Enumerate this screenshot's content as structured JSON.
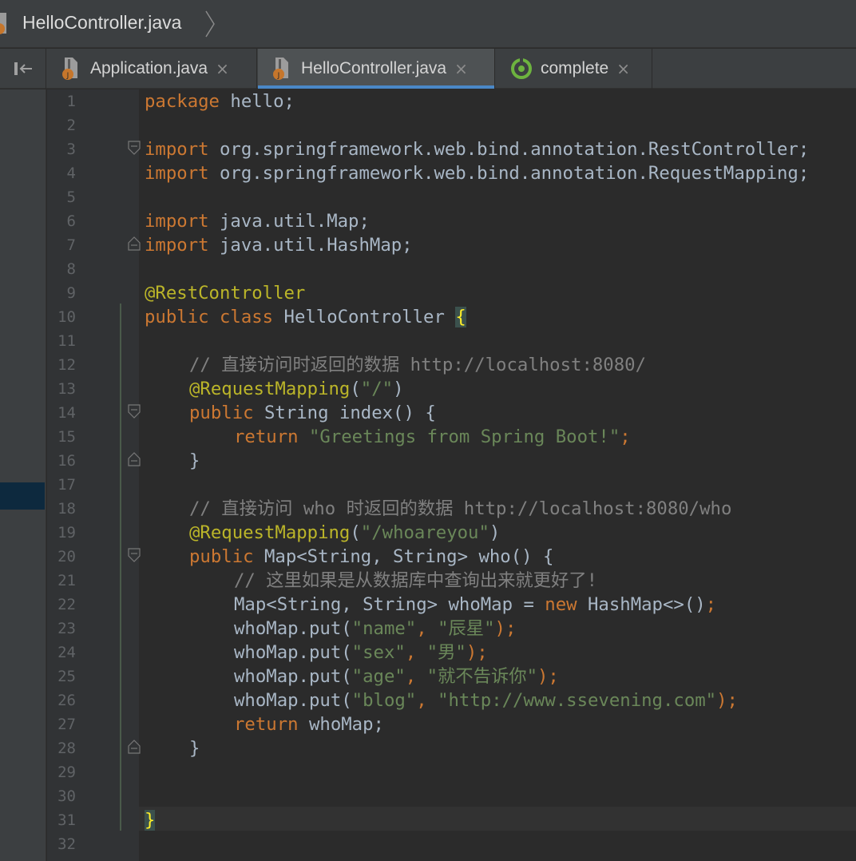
{
  "breadcrumb": {
    "file": "HelloController.java"
  },
  "tabs": [
    {
      "label": "Application.java",
      "close": "×",
      "icon": "java-file-icon"
    },
    {
      "label": "HelloController.java",
      "close": "×",
      "icon": "java-file-icon",
      "active": true
    },
    {
      "label": "complete",
      "close": "×",
      "icon": "spring-boot-icon"
    }
  ],
  "colors": {
    "keyword": "#cc7832",
    "string": "#6a8759",
    "annotation": "#bbb529",
    "comment": "#808080",
    "text": "#a9b7c6",
    "background": "#2b2b2b",
    "active_tab_underline": "#4a88c7"
  },
  "editor": {
    "line_numbers": [
      "1",
      "2",
      "3",
      "4",
      "5",
      "6",
      "7",
      "8",
      "9",
      "10",
      "11",
      "12",
      "13",
      "14",
      "15",
      "16",
      "17",
      "18",
      "19",
      "20",
      "21",
      "22",
      "23",
      "24",
      "25",
      "26",
      "27",
      "28",
      "29",
      "30",
      "31",
      "32"
    ],
    "code": {
      "l1_kw": "package",
      "l1_rest": " hello;",
      "l3_kw": "import",
      "l3_rest": " org.springframework.web.bind.annotation.RestController;",
      "l4_kw": "import",
      "l4_rest": " org.springframework.web.bind.annotation.RequestMapping;",
      "l6_kw": "import",
      "l6_rest": " java.util.Map;",
      "l7_kw": "import",
      "l7_rest": " java.util.HashMap;",
      "l9_ann": "@RestController",
      "l10_kw": "public class",
      "l10_rest": " HelloController ",
      "l10_brace": "{",
      "l12_cmt": "// 直接访问时返回的数据 http://localhost:8080/",
      "l13_ann": "@RequestMapping",
      "l13_open": "(",
      "l13_str": "\"/\"",
      "l13_close": ")",
      "l14_kw": "public",
      "l14_rest": " String index() {",
      "l15_kw": "return",
      "l15_str": " \"Greetings from Spring Boot!\"",
      "l15_semi": ";",
      "l16": "}",
      "l18_cmt": "// 直接访问 who 时返回的数据 http://localhost:8080/who",
      "l19_ann": "@RequestMapping",
      "l19_open": "(",
      "l19_str": "\"/whoareyou\"",
      "l19_close": ")",
      "l20_kw": "public",
      "l20_rest": " Map<String, String> who() {",
      "l21_cmt": "// 这里如果是从数据库中查询出来就更好了!",
      "l22_a": "Map<String, String> whoMap = ",
      "l22_kw": "new",
      "l22_b": " HashMap<>()",
      "l22_semi": ";",
      "l23_a": "whoMap.put(",
      "l23_s1": "\"name\"",
      "l23_c": ", ",
      "l23_s2": "\"辰星\"",
      "l23_e": ");",
      "l24_a": "whoMap.put(",
      "l24_s1": "\"sex\"",
      "l24_c": ", ",
      "l24_s2": "\"男\"",
      "l24_e": ");",
      "l25_a": "whoMap.put(",
      "l25_s1": "\"age\"",
      "l25_c": ", ",
      "l25_s2": "\"就不告诉你\"",
      "l25_e": ");",
      "l26_a": "whoMap.put(",
      "l26_s1": "\"blog\"",
      "l26_c": ", ",
      "l26_s2": "\"http://www.ssevening.com\"",
      "l26_e": ");",
      "l27_kw": "return",
      "l27_rest": " whoMap;",
      "l28": "}",
      "l31_brace": "}"
    }
  }
}
